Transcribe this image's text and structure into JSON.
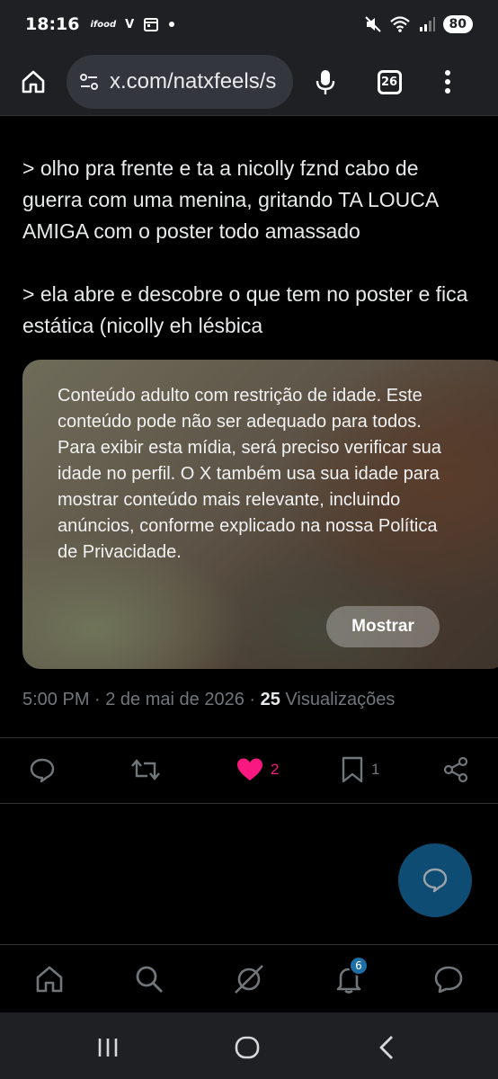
{
  "status_bar": {
    "time": "18:16",
    "battery": "80",
    "left_icons": [
      "ifood-icon",
      "v-icon",
      "calendar-icon",
      "dot-icon"
    ],
    "right_icons": [
      "mute-icon",
      "wifi-icon",
      "signal-icon",
      "battery-icon"
    ]
  },
  "browser": {
    "url": "x.com/natxfeels/s",
    "tab_count": "26"
  },
  "tweet": {
    "paragraphs": [
      "> olho pra frente e ta a nicolly fznd cabo de guerra com uma menina, gritando TA LOUCA AMIGA com o poster todo amassado",
      "> ela abre e descobre o que tem no poster e fica estática (nicolly eh lésbica"
    ],
    "sensitive_notice": "Conteúdo adulto com restrição de idade. Este conteúdo pode não ser adequado para todos. Para exibir esta mídia, será preciso verificar sua idade no perfil. O X também usa sua idade para mostrar conteúdo mais relevante, incluindo anúncios, conforme explicado na nossa Política de Privacidade.",
    "show_button": "Mostrar",
    "timestamp": "5:00 PM · 2 de mai de 2026 ·",
    "views_count": "25",
    "views_label": "Visualizações"
  },
  "actions": {
    "like_count": "2",
    "bookmark_count": "1"
  },
  "bottom_nav": {
    "notifications_badge": "6"
  },
  "colors": {
    "background": "#000000",
    "like": "#f91880",
    "muted_text": "#71767b",
    "fab": "#0f4c73"
  }
}
